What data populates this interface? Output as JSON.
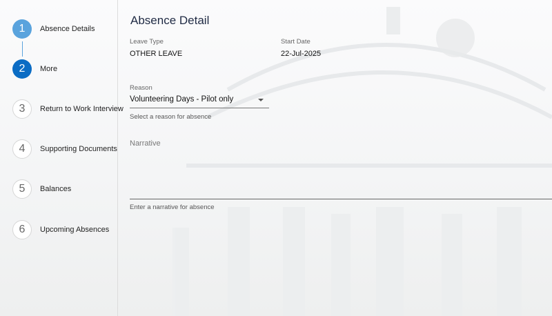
{
  "stepper": {
    "steps": [
      {
        "number": "1",
        "label": "Absence Details",
        "state": "done"
      },
      {
        "number": "2",
        "label": "More",
        "state": "active"
      },
      {
        "number": "3",
        "label": "Return to Work Interview",
        "state": "todo"
      },
      {
        "number": "4",
        "label": "Supporting Documents",
        "state": "todo"
      },
      {
        "number": "5",
        "label": "Balances",
        "state": "todo"
      },
      {
        "number": "6",
        "label": "Upcoming Absences",
        "state": "todo"
      }
    ]
  },
  "main": {
    "title": "Absence Detail",
    "leave_type": {
      "label": "Leave Type",
      "value": "OTHER LEAVE"
    },
    "start_date": {
      "label": "Start Date",
      "value": "22-Jul-2025"
    },
    "reason": {
      "label": "Reason",
      "value": "Volunteering Days - Pilot only",
      "hint": "Select a reason for absence"
    },
    "narrative": {
      "placeholder": "Narrative",
      "hint": "Enter a narrative for absence"
    }
  },
  "colors": {
    "step_done": "#5aa3dd",
    "step_active": "#0b6cc4",
    "title": "#1f2a44"
  }
}
